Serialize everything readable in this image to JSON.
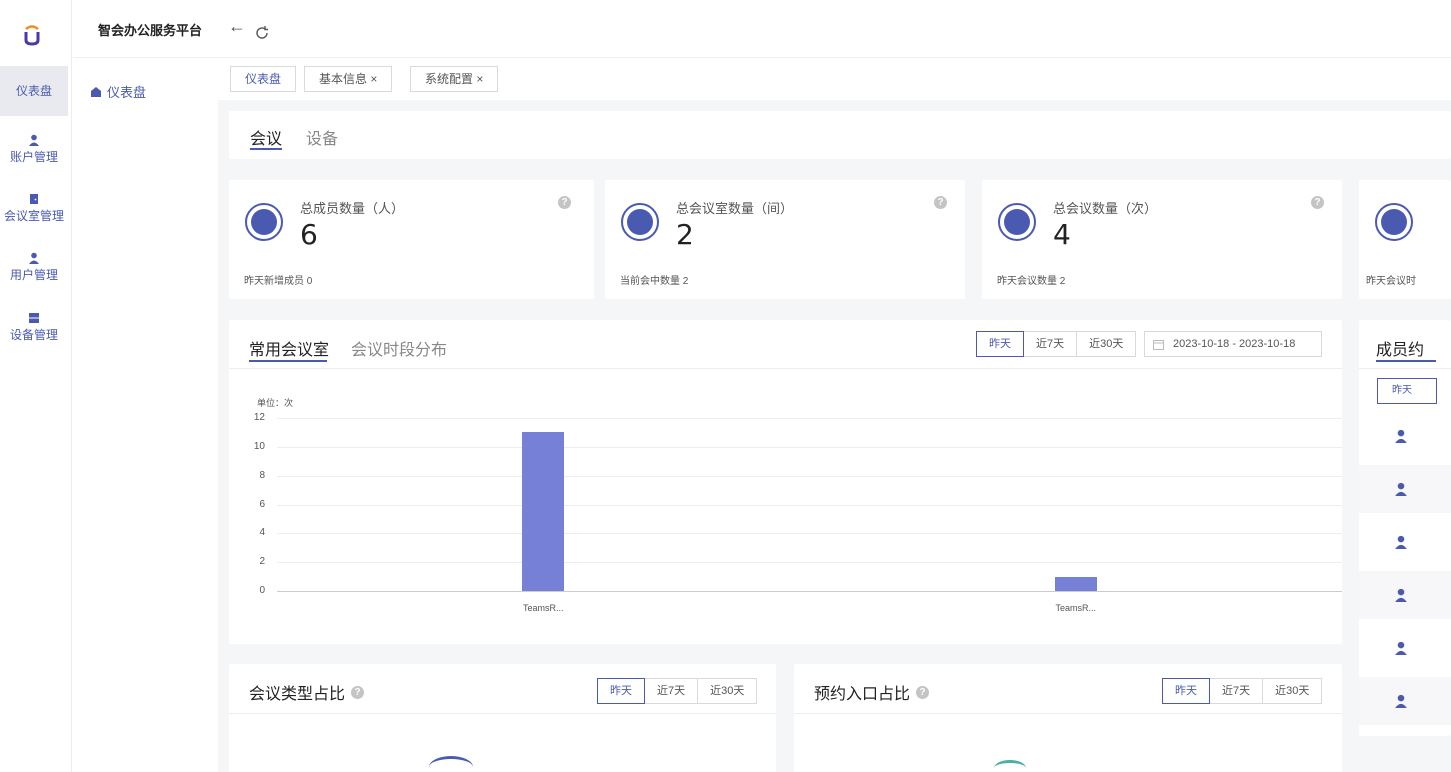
{
  "header": {
    "title": "智会办公服务平台",
    "back_icon": "←",
    "refresh_icon": "C"
  },
  "nav": {
    "items": [
      {
        "label": "仪表盘",
        "icon": "dashboard-icon"
      },
      {
        "label": "账户管理",
        "icon": "user-icon"
      },
      {
        "label": "会议室管理",
        "icon": "door-icon"
      },
      {
        "label": "用户管理",
        "icon": "user-icon"
      },
      {
        "label": "设备管理",
        "icon": "server-icon"
      }
    ]
  },
  "subnav": {
    "home_label": "仪表盘"
  },
  "tabs": {
    "items": [
      {
        "label": "仪表盘"
      },
      {
        "label": "基本信息 ×"
      },
      {
        "label": "系统配置 ×"
      }
    ]
  },
  "section_tabs": {
    "items": [
      "会议",
      "设备"
    ],
    "active": "会议"
  },
  "stats": [
    {
      "title": "总成员数量（人）",
      "value": "6",
      "sub": "昨天新增成员  0"
    },
    {
      "title": "总会议室数量（间）",
      "value": "2",
      "sub": "当前会中数量  2"
    },
    {
      "title": "总会议数量（次）",
      "value": "4",
      "sub": "昨天会议数量  2"
    },
    {
      "title": "",
      "value": "",
      "sub": "昨天会议时"
    }
  ],
  "room_panel": {
    "tab_active": "常用会议室",
    "tab_other": "会议时段分布",
    "ranges": [
      "昨天",
      "近7天",
      "近30天"
    ],
    "date_range": "2023-10-18  -  2023-10-18",
    "unit_label": "单位：次"
  },
  "chart_data": {
    "type": "bar",
    "categories": [
      "TeamsR...",
      "TeamsR..."
    ],
    "values": [
      11,
      1
    ],
    "ylabel": "单位：次",
    "ylim": [
      0,
      12
    ],
    "yticks": [
      "12",
      "10",
      "8",
      "6",
      "4",
      "2",
      "0"
    ],
    "grid": true
  },
  "member_panel": {
    "title": "成员约",
    "range_label": "昨天"
  },
  "type_panel": {
    "title": "会议类型占比",
    "ranges": [
      "昨天",
      "近7天",
      "近30天"
    ]
  },
  "entry_panel": {
    "title": "预约入口占比",
    "ranges": [
      "昨天",
      "近7天",
      "近30天"
    ]
  },
  "colors": {
    "accent": "#4a5ab0",
    "bar": "#7580d6"
  }
}
